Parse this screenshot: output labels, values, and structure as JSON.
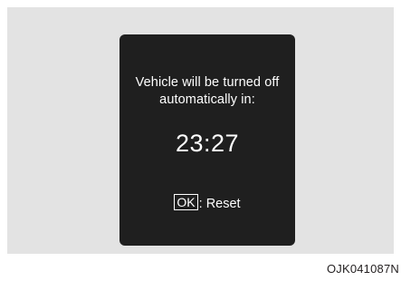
{
  "screen": {
    "message_line1": "Vehicle will be turned off",
    "message_line2": "automatically in:",
    "countdown": "23:27",
    "ok_key_label": "OK",
    "reset_label": ": Reset"
  },
  "figure": {
    "caption": "OJK041087N"
  },
  "colors": {
    "panel_background": "#e3e3e3",
    "screen_background": "#1f1f1f",
    "text": "#ffffff"
  }
}
